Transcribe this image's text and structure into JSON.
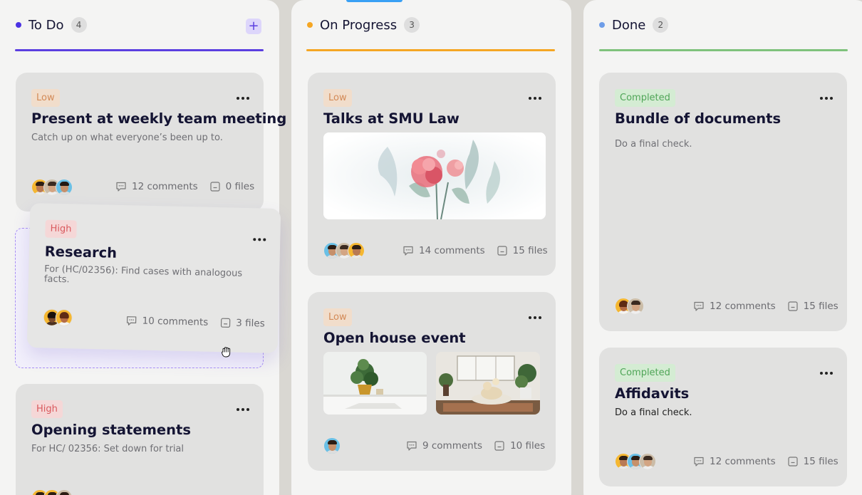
{
  "columns": [
    {
      "title": "To Do",
      "count": "4",
      "add_icon": "plus-icon",
      "dot_color": "#4b32e3",
      "line_color": "#5b3fe0",
      "cards": [
        {
          "tag": "Low",
          "title": "Present at weekly team meeting",
          "description": "Catch up on what everyone’s been up to.",
          "comments": "12 comments",
          "files": "0 files"
        },
        {
          "tag": "High",
          "title": "Research",
          "description": "For (HC/02356): Find cases with analogous facts.",
          "comments": "10 comments",
          "files": "3 files",
          "state": "dragging"
        },
        {
          "tag": "High",
          "title": "Opening statements",
          "description": "For HC/ 02356: Set down for trial"
        }
      ]
    },
    {
      "title": "On Progress",
      "count": "3",
      "dot_color": "#f5a623",
      "line_color": "#f5a623",
      "cards": [
        {
          "tag": "Low",
          "title": "Talks at SMU Law",
          "image": "flowers-illustration",
          "comments": "14 comments",
          "files": "15 files"
        },
        {
          "tag": "Low",
          "title": "Open house event",
          "images": [
            "plant-on-desk-photo",
            "dog-in-living-room-photo"
          ],
          "comments": "9 comments",
          "files": "10 files"
        }
      ]
    },
    {
      "title": "Done",
      "count": "2",
      "dot_color": "#6e9de8",
      "line_color": "#7fc27c",
      "cards": [
        {
          "tag": "Completed",
          "title": "Bundle of documents",
          "description": "Do a final check.",
          "comments": "12 comments",
          "files": "15 files"
        },
        {
          "tag": "Completed",
          "title": "Affidavits",
          "description": "Do a final check.",
          "comments": "12 comments",
          "files": "15 files"
        }
      ]
    }
  ],
  "colors": {
    "low_tag": "#d38a57",
    "high_tag": "#d9595d",
    "completed_tag": "#4fa557",
    "drop_zone_border": "#a990f5"
  },
  "icons": {
    "comment": "comment-icon",
    "file": "file-icon",
    "more": "more-icon",
    "cursor": "grab-hand-cursor"
  }
}
